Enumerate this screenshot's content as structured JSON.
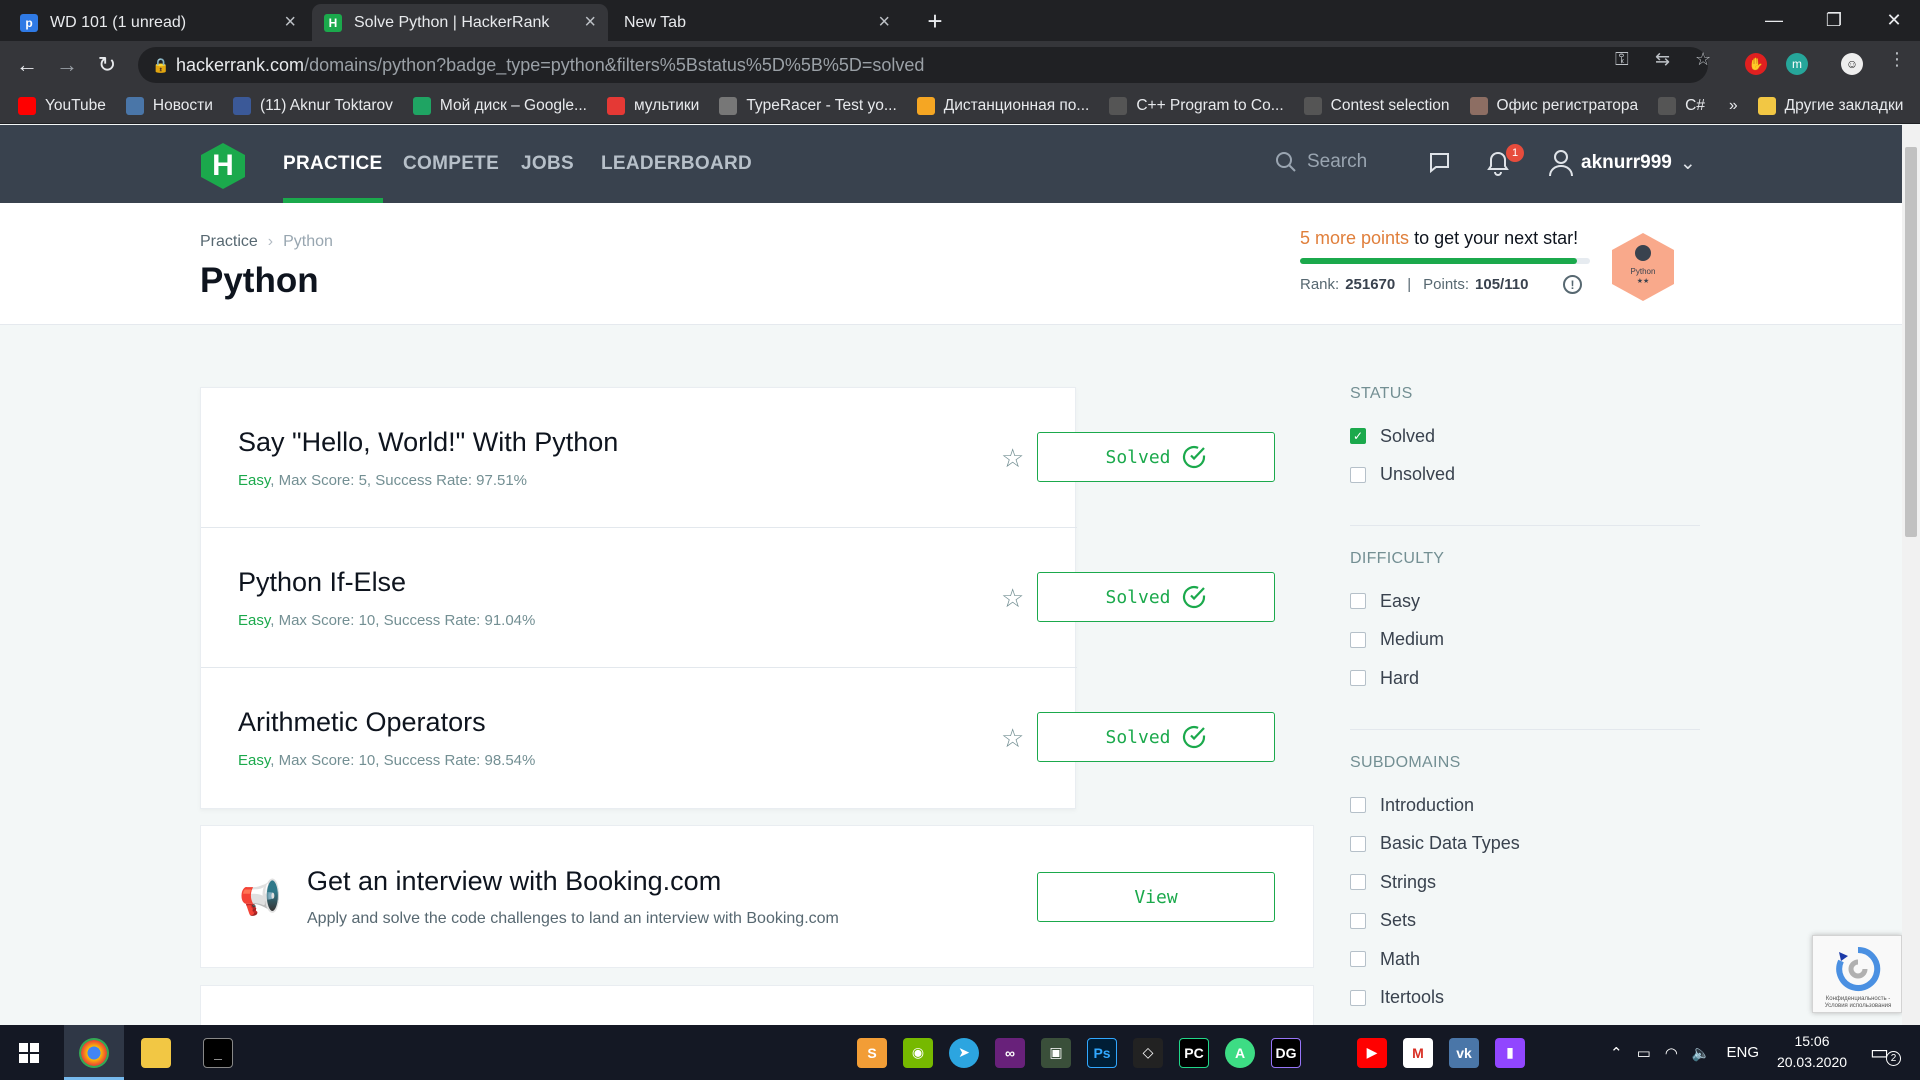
{
  "browser": {
    "tabs": [
      {
        "title": "WD 101 (1 unread)",
        "active": false
      },
      {
        "title": "Solve Python | HackerRank",
        "active": true
      },
      {
        "title": "New Tab",
        "active": false
      }
    ],
    "url_host": "hackerrank.com",
    "url_path": "/domains/python?badge_type=python&filters%5Bstatus%5D%5B%5D=solved",
    "bookmarks": [
      {
        "label": "YouTube",
        "icon": "youtube-icon",
        "color": "#ff0000"
      },
      {
        "label": "Новости",
        "icon": "vk-icon",
        "color": "#4a76a8"
      },
      {
        "label": "(11) Aknur Toktarov",
        "icon": "facebook-icon",
        "color": "#3b5998"
      },
      {
        "label": "Мой диск – Google...",
        "icon": "google-drive-icon",
        "color": "#1fa463"
      },
      {
        "label": "мультики",
        "icon": "site-icon",
        "color": "#e53935"
      },
      {
        "label": "TypeRacer - Test yo...",
        "icon": "typeracer-icon",
        "color": "#777777"
      },
      {
        "label": "Дистанционная по...",
        "icon": "site-icon",
        "color": "#f5a623"
      },
      {
        "label": "C++ Program to Co...",
        "icon": "text-icon",
        "color": "#555555"
      },
      {
        "label": "Contest selection",
        "icon": "globe-icon",
        "color": "#555555"
      },
      {
        "label": "Офис регистратора",
        "icon": "site-icon",
        "color": "#8d6e63"
      },
      {
        "label": "C#",
        "icon": "page-icon",
        "color": "#555555"
      }
    ],
    "bookmarks_more": "»",
    "other_bookmarks": "Другие закладки"
  },
  "hackerrank": {
    "nav": [
      "PRACTICE",
      "COMPETE",
      "JOBS",
      "LEADERBOARD"
    ],
    "search_placeholder": "Search",
    "notification_count": "1",
    "username": "aknurr999",
    "breadcrumb": [
      "Practice",
      "Python"
    ],
    "page_title": "Python",
    "star_points": "5 more points",
    "star_suffix": " to get your next star!",
    "star_progress": 0.955,
    "rank_label": "Rank:",
    "rank_value": "251670",
    "points_label": "Points:",
    "points_value": "105/110",
    "badge_label": "Python",
    "badge_stars": "★★",
    "badge_color": "#f9a98b"
  },
  "challenges": [
    {
      "title": "Say \"Hello, World!\" With Python",
      "difficulty": "Easy",
      "meta": ", Max Score: 5, Success Rate: 97.51%",
      "status": "Solved"
    },
    {
      "title": "Python If-Else",
      "difficulty": "Easy",
      "meta": ", Max Score: 10, Success Rate: 91.04%",
      "status": "Solved"
    },
    {
      "title": "Arithmetic Operators",
      "difficulty": "Easy",
      "meta": ", Max Score: 10, Success Rate: 98.54%",
      "status": "Solved"
    }
  ],
  "ad": {
    "title": "Get an interview with Booking.com",
    "description": "Apply and solve the code challenges to land an interview with Booking.com",
    "button": "View"
  },
  "filters": {
    "status": {
      "heading": "STATUS",
      "options": [
        {
          "label": "Solved",
          "checked": true
        },
        {
          "label": "Unsolved",
          "checked": false
        }
      ]
    },
    "difficulty": {
      "heading": "DIFFICULTY",
      "options": [
        {
          "label": "Easy",
          "checked": false
        },
        {
          "label": "Medium",
          "checked": false
        },
        {
          "label": "Hard",
          "checked": false
        }
      ]
    },
    "subdomains": {
      "heading": "SUBDOMAINS",
      "options": [
        {
          "label": "Introduction",
          "checked": false
        },
        {
          "label": "Basic Data Types",
          "checked": false
        },
        {
          "label": "Strings",
          "checked": false
        },
        {
          "label": "Sets",
          "checked": false
        },
        {
          "label": "Math",
          "checked": false
        },
        {
          "label": "Itertools",
          "checked": false
        }
      ]
    }
  },
  "recaptcha_text": "Конфиденциальность - Условия использования",
  "taskbar": {
    "language": "ENG",
    "time": "15:06",
    "date": "20.03.2020",
    "notifications": "2"
  },
  "colors": {
    "accent": "#1ba94c",
    "nav_bg": "#39424e",
    "orange": "#e07f3b"
  }
}
